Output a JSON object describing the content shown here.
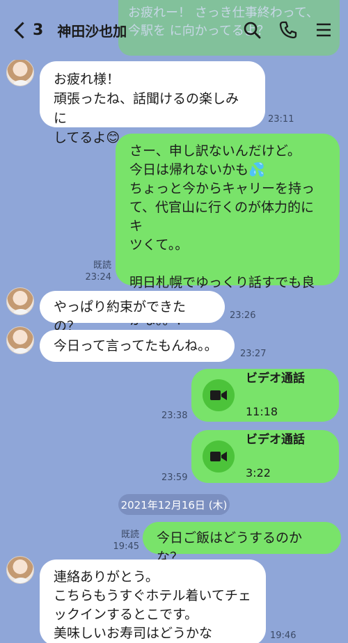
{
  "header": {
    "back_count": "3",
    "contact_name": "神田沙也加",
    "icons": [
      "search-icon",
      "phone-icon",
      "menu-icon"
    ],
    "peek_text": "お疲れー！\nさっき仕事終わって、今駅を\nに向かってるよ？"
  },
  "colors": {
    "background": "#8fa6d8",
    "incoming_bubble": "#ffffff",
    "outgoing_bubble": "#79e36a",
    "call_icon_circle": "#4cc33a"
  },
  "messages": [
    {
      "id": "m1",
      "side": "left",
      "text": "お疲れ様！\n頑張ったね、話聞けるの楽しみに\nしてるよ😊",
      "time": "23:11"
    },
    {
      "id": "m2",
      "side": "right",
      "text": "さー、申し訳ないんだけど。\n今日は帰れないかも💦\nちょっと今からキャリーを持っ\nて、代官山に行くのが体力的にキ\nツくて。。\n\n明日札幌でゆっくり話すでも良い\nかな。。？",
      "read": "既読",
      "time": "23:24"
    },
    {
      "id": "m3",
      "side": "left",
      "text": "やっぱり約束ができたの？",
      "time": "23:26"
    },
    {
      "id": "m4",
      "side": "left",
      "text": "今日って言ってたもんね。。",
      "time": "23:27"
    },
    {
      "id": "m5",
      "side": "right",
      "type": "call",
      "label": "ビデオ通話",
      "duration": "11:18",
      "time": "23:38"
    },
    {
      "id": "m6",
      "side": "right",
      "type": "call",
      "label": "ビデオ通話",
      "duration": "3:22",
      "time": "23:59"
    },
    {
      "id": "m7",
      "side": "right",
      "text": "今日ご飯はどうするのかな？",
      "read": "既読",
      "time": "19:45"
    },
    {
      "id": "m8",
      "side": "left",
      "text": "連絡ありがとう。\nこちらもうすぐホテル着いてチェ\nックインするとこです。\n美味しいお寿司はどうかな",
      "time": "19:46"
    }
  ],
  "date_separator": "2021年12月16日 (木)"
}
